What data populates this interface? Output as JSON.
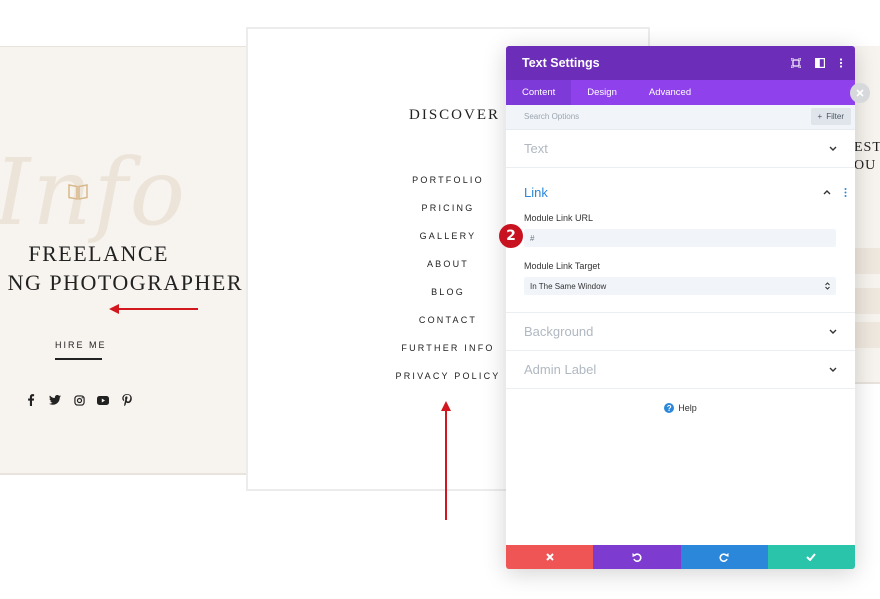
{
  "left_card": {
    "script_text": "Info",
    "headline_line1": "FREELANCE",
    "headline_line2": "NG PHOTOGRAPHER",
    "hire_link": "HIRE ME",
    "socials": [
      "facebook-icon",
      "twitter-icon",
      "instagram-icon",
      "youtube-icon",
      "pinterest-icon"
    ]
  },
  "middle_card": {
    "title": "DISCOVER",
    "menu": [
      "PORTFOLIO",
      "PRICING",
      "GALLERY",
      "ABOUT",
      "BLOG",
      "CONTACT",
      "FURTHER INFO",
      "PRIVACY POLICY"
    ]
  },
  "right_card": {
    "line1": "EST",
    "line2": "OU"
  },
  "modal": {
    "title": "Text Settings",
    "tabs": [
      "Content",
      "Design",
      "Advanced"
    ],
    "active_tab": "Content",
    "search_placeholder": "Search Options",
    "filter_label": "Filter",
    "sections": {
      "text": "Text",
      "link": "Link",
      "background": "Background",
      "admin_label": "Admin Label"
    },
    "link_url_label": "Module Link URL",
    "link_url_value": "#",
    "link_target_label": "Module Link Target",
    "link_target_value": "In The Same Window",
    "help_label": "Help",
    "badge_number": "2"
  },
  "colors": {
    "header_purple": "#6c2eb9",
    "tab_purple": "#8f42ec",
    "link_blue": "#2b87da",
    "cancel_red": "#ef5555",
    "undo_purple": "#7e3bd0",
    "redo_blue": "#2b87da",
    "save_green": "#29c4a9",
    "arrow_red": "#d3171e"
  }
}
